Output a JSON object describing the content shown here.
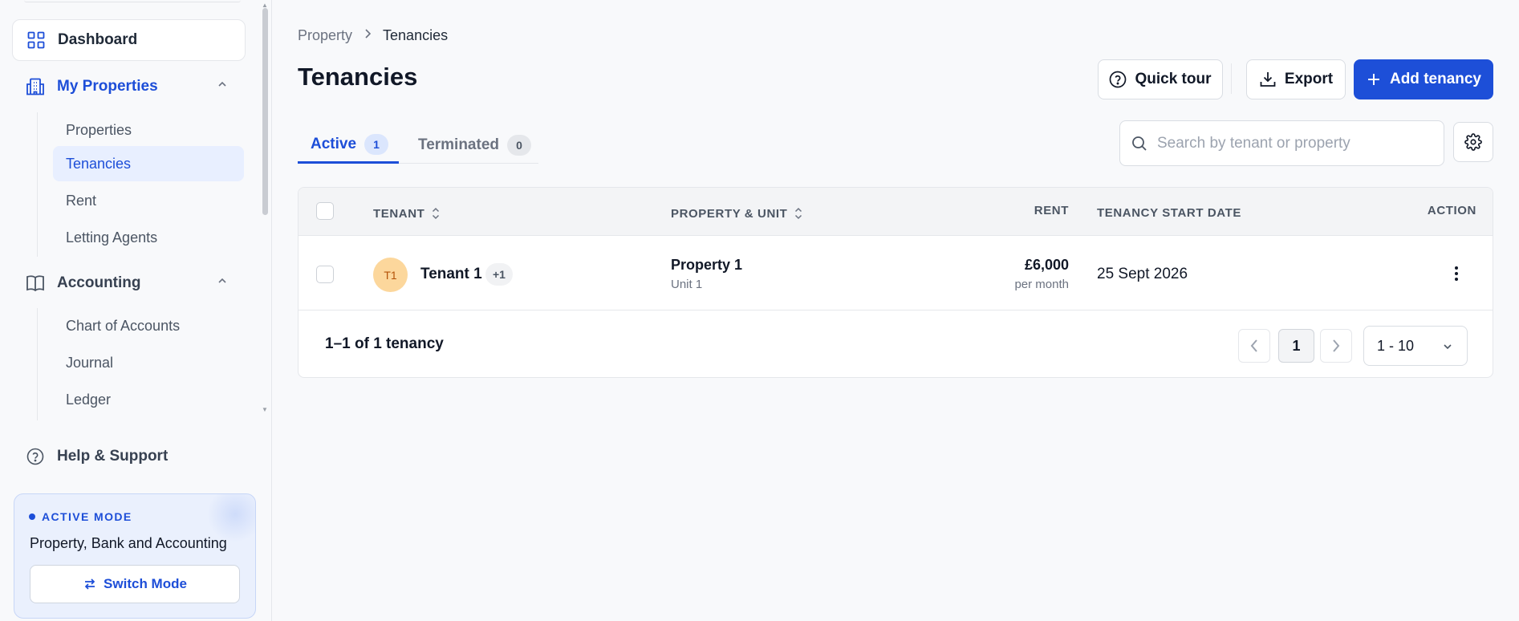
{
  "sidebar": {
    "dashboard_label": "Dashboard",
    "my_properties_label": "My Properties",
    "my_properties_items": [
      "Properties",
      "Tenancies",
      "Rent",
      "Letting Agents"
    ],
    "accounting_label": "Accounting",
    "accounting_items": [
      "Chart of Accounts",
      "Journal",
      "Ledger"
    ],
    "help_label": "Help & Support",
    "active_item": "Tenancies",
    "mode": {
      "tag": "ACTIVE MODE",
      "name": "Property, Bank and Accounting",
      "switch_label": "Switch Mode"
    }
  },
  "breadcrumb": {
    "root": "Property",
    "current": "Tenancies"
  },
  "page": {
    "title": "Tenancies"
  },
  "header_actions": {
    "quick_tour": "Quick tour",
    "export": "Export",
    "add": "Add tenancy"
  },
  "tabs": [
    {
      "label": "Active",
      "count": "1",
      "active": true
    },
    {
      "label": "Terminated",
      "count": "0",
      "active": false
    }
  ],
  "search": {
    "placeholder": "Search by tenant or property",
    "value": ""
  },
  "table": {
    "columns": {
      "tenant": "TENANT",
      "property": "PROPERTY & UNIT",
      "rent": "RENT",
      "start_date": "TENANCY START DATE",
      "action": "ACTION"
    },
    "rows": [
      {
        "avatar_initials": "T1",
        "tenant": "Tenant 1",
        "extra_tenants": "+1",
        "property": "Property 1",
        "unit": "Unit 1",
        "rent": "£6,000",
        "rent_period": "per month",
        "start_date": "25 Sept 2026"
      }
    ]
  },
  "pagination": {
    "summary": "1–1 of 1 tenancy",
    "current_page": "1",
    "page_size": "1 - 10"
  },
  "colors": {
    "primary": "#1d4fd8",
    "avatar_bg": "#fcd79c",
    "active_nav_bg": "#e8efff",
    "page_bg": "#f8f9fb"
  },
  "icons": {
    "dashboard": "grid-icon",
    "my_properties": "building-icon",
    "accounting": "book-icon",
    "help": "help-circle-icon",
    "quick_tour": "help-circle-icon",
    "export": "download-icon",
    "add": "plus-icon",
    "search": "search-icon",
    "settings": "gear-icon",
    "sort": "sort-icon",
    "action": "kebab-icon",
    "switch": "swap-icon"
  }
}
